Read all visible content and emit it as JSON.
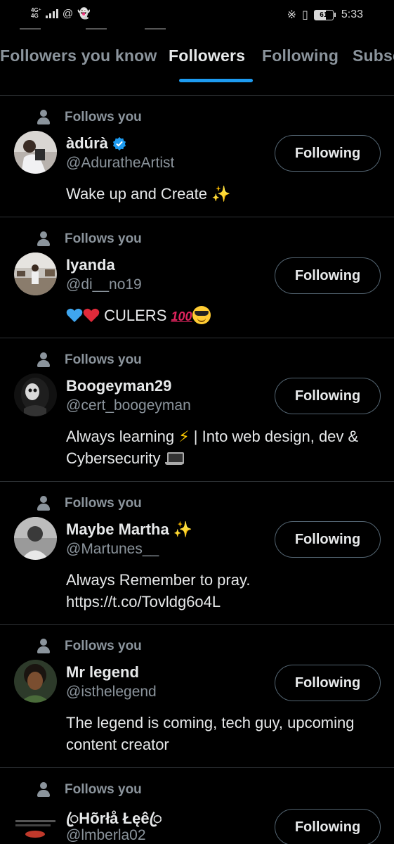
{
  "status_bar": {
    "network_top": "4G⁺",
    "network_bottom": "4G",
    "extra_icons": "@",
    "battery": "61",
    "time": "5:33"
  },
  "tabs": [
    {
      "label": "Followers you know",
      "active": false
    },
    {
      "label": "Followers",
      "active": true
    },
    {
      "label": "Following",
      "active": false
    },
    {
      "label": "Subscriptions",
      "active": false
    }
  ],
  "accent_color": "#1d9bf0",
  "users": [
    {
      "follows_you": "Follows you",
      "name": "àdúrà",
      "verified": true,
      "handle": "@AduratheArtist",
      "bio": "Wake up and Create ✨",
      "button": "Following"
    },
    {
      "follows_you": "Follows you",
      "name": "Iyanda",
      "verified": false,
      "handle": "@di__no19",
      "bio": "CULERS",
      "button": "Following"
    },
    {
      "follows_you": "Follows you",
      "name": "Boogeyman29",
      "verified": false,
      "handle": "@cert_boogeyman",
      "bio_part1": "Always learning",
      "bio_part2": "| Into web design, dev & Cybersecurity",
      "button": "Following"
    },
    {
      "follows_you": "Follows you",
      "name": "Maybe Martha ✨",
      "verified": false,
      "handle": "@Martunes__",
      "bio": "Always Remember to pray. https://t.co/Tovldg6o4L",
      "button": "Following"
    },
    {
      "follows_you": "Follows you",
      "name": "Mr legend",
      "verified": false,
      "handle": "@isthelegend",
      "bio": "The legend is coming, tech guy, upcoming content creator",
      "button": "Following"
    },
    {
      "follows_you": "Follows you",
      "name": "ꦿHõrłå Łęêꦿ",
      "verified": false,
      "handle": "@lmberla02",
      "button": "Following"
    }
  ]
}
